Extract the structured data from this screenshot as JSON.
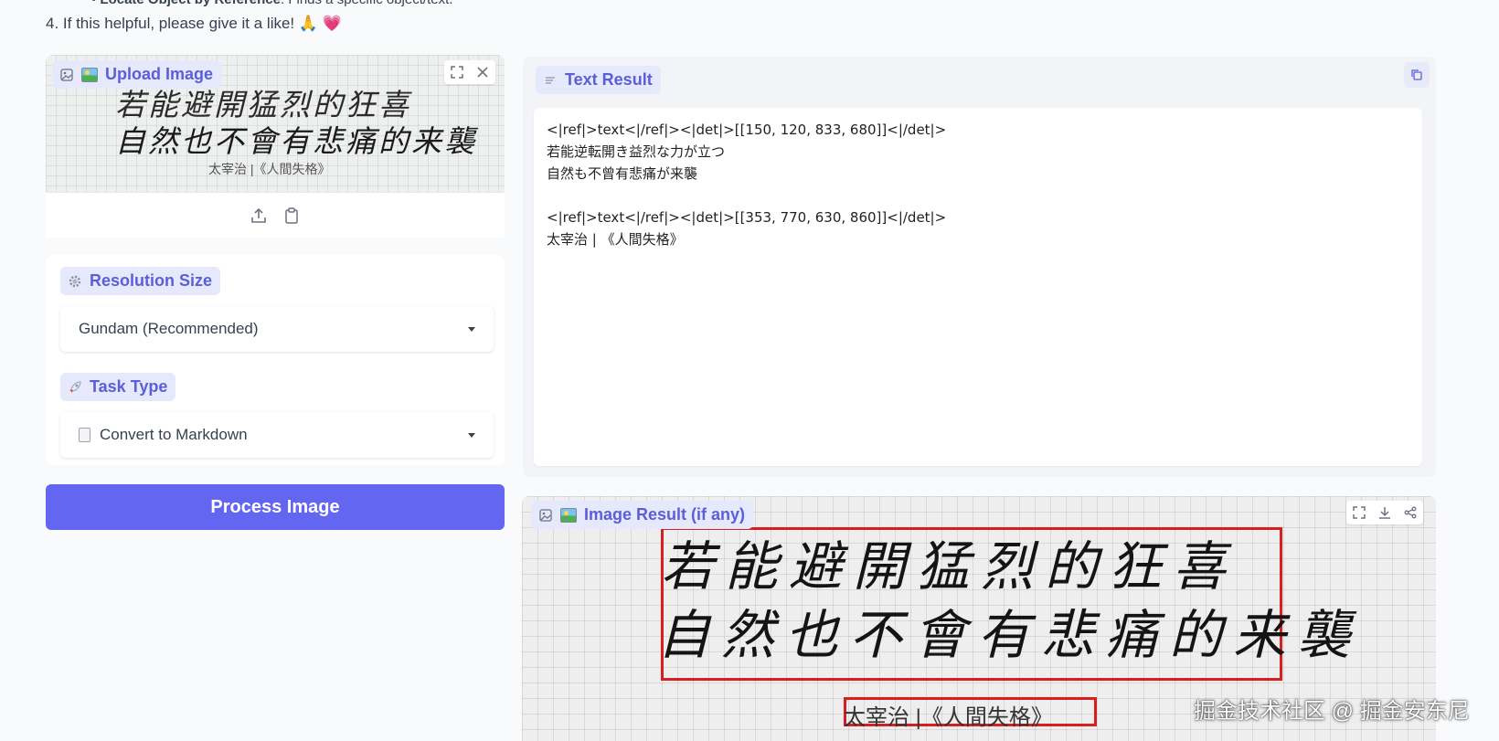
{
  "intro": {
    "cut_line_bold": "Locate Object by Reference",
    "cut_line_rest": ": Finds a specific object/text.",
    "like_line": "4. If this helpful, please give it a like!",
    "like_emoji_1": "🙏",
    "like_emoji_2": "💗"
  },
  "upload": {
    "label": "Upload Image",
    "preview_line_1": "若能避開猛烈的狂喜",
    "preview_line_2": "自然也不會有悲痛的来襲",
    "preview_signature": "太宰治 |《人間失格》",
    "icons": [
      "image-icon",
      "fullscreen-icon",
      "close-icon",
      "upload-icon",
      "clipboard-icon"
    ]
  },
  "settings": {
    "resolution_label": "Resolution Size",
    "resolution_value": "Gundam (Recommended)",
    "task_label": "Task Type",
    "task_value": "Convert to Markdown"
  },
  "process_button": "Process Image",
  "text_result": {
    "label": "Text Result",
    "lines": [
      "<|ref|>text<|/ref|><|det|>[[150, 120, 833, 680]]<|/det|>",
      "若能逆転開き益烈な力が立つ",
      "自然も不曾有悲痛が来襲",
      "",
      "<|ref|>text<|/ref|><|det|>[[353, 770, 630, 860]]<|/det|>",
      "太宰治 | 《人間失格》"
    ]
  },
  "image_result": {
    "label": "Image Result (if any)",
    "line_1": "若能避開猛烈的狂喜",
    "line_2": "自然也不會有悲痛的来襲",
    "signature": "太宰治 |《人間失格》",
    "box_color": "#d61f1f",
    "icons": [
      "fullscreen-icon",
      "download-icon",
      "share-icon"
    ]
  },
  "watermark": "掘金技术社区 @ 掘金安东尼",
  "colors": {
    "accent": "#6366f1",
    "label_bg": "#e6e8fb",
    "label_text": "#5a5fd9"
  }
}
